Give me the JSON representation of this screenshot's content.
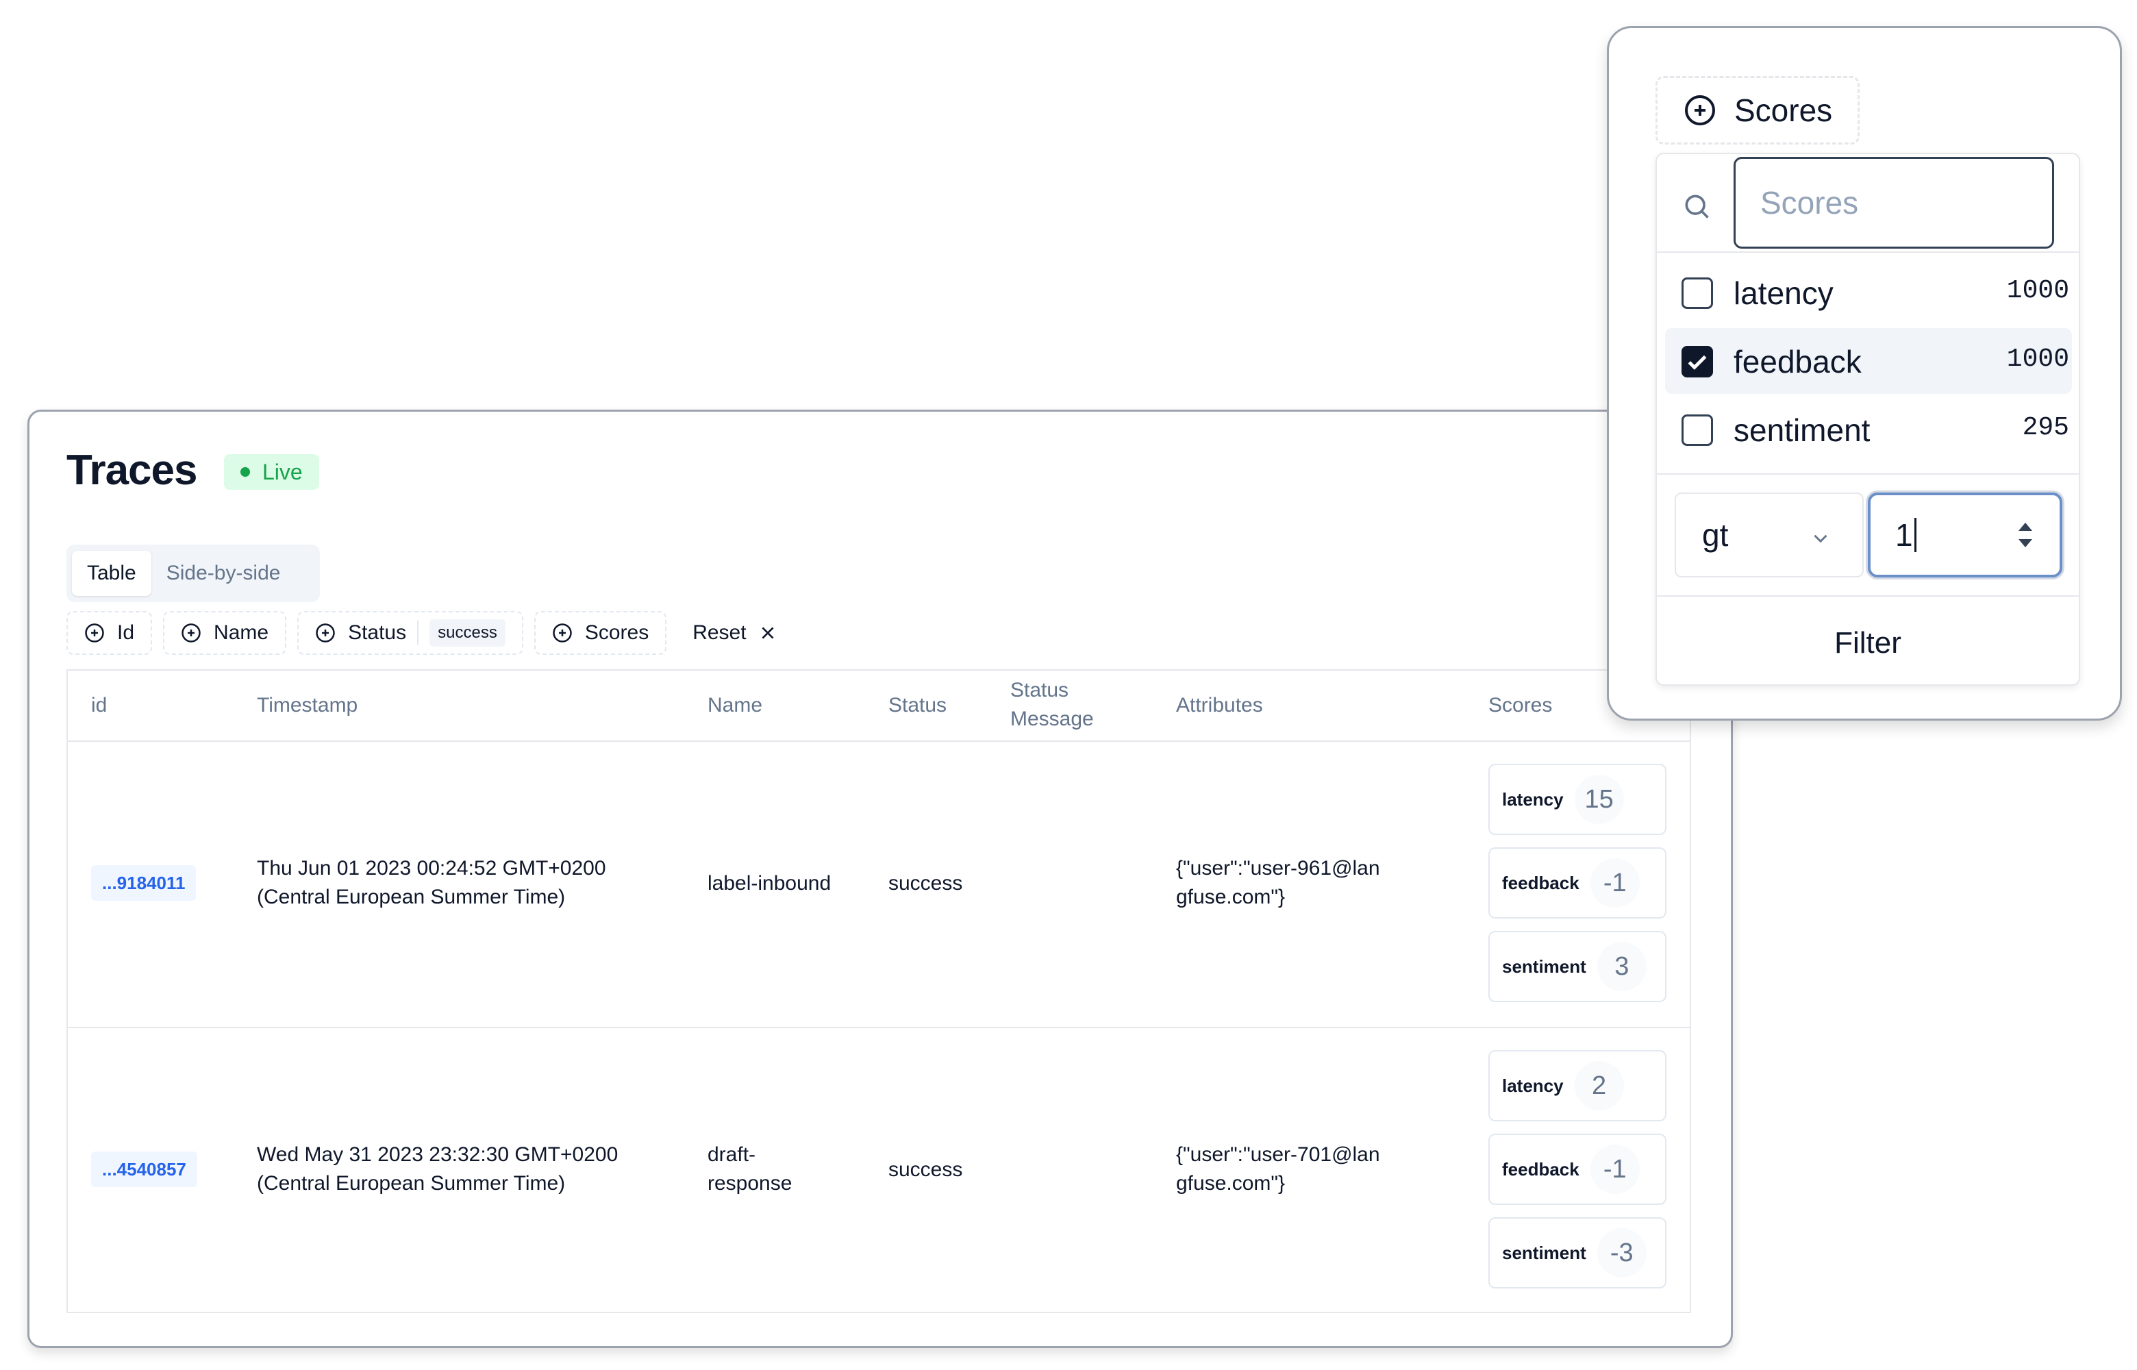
{
  "traces": {
    "title": "Traces",
    "live_label": "Live",
    "tabs": [
      {
        "label": "Table",
        "active": true
      },
      {
        "label": "Side-by-side",
        "active": false
      }
    ],
    "filters": [
      {
        "label": "Id"
      },
      {
        "label": "Name"
      },
      {
        "label": "Status",
        "value": "success"
      },
      {
        "label": "Scores"
      }
    ],
    "reset_label": "Reset",
    "columns": [
      "id",
      "Timestamp",
      "Name",
      "Status",
      "Status Message",
      "Attributes",
      "Scores"
    ],
    "rows": [
      {
        "id": "...9184011",
        "timestamp": "Thu Jun 01 2023 00:24:52 GMT+0200 (Central European Summer Time)",
        "name": "label-inbound",
        "status": "success",
        "status_message": "",
        "attributes": "{\"user\":\"user-961@langfuse.com\"}",
        "scores": [
          {
            "name": "latency",
            "value": "15"
          },
          {
            "name": "feedback",
            "value": "-1"
          },
          {
            "name": "sentiment",
            "value": "3"
          }
        ]
      },
      {
        "id": "...4540857",
        "timestamp": "Wed May 31 2023 23:32:30 GMT+0200 (Central European Summer Time)",
        "name": "draft-response",
        "status": "success",
        "status_message": "",
        "attributes": "{\"user\":\"user-701@langfuse.com\"}",
        "scores": [
          {
            "name": "latency",
            "value": "2"
          },
          {
            "name": "feedback",
            "value": "-1"
          },
          {
            "name": "sentiment",
            "value": "-3"
          }
        ]
      }
    ]
  },
  "scores_popover": {
    "trigger_label": "Scores",
    "search_placeholder": "Scores",
    "options": [
      {
        "name": "latency",
        "count": "1000",
        "checked": false
      },
      {
        "name": "feedback",
        "count": "1000",
        "checked": true
      },
      {
        "name": "sentiment",
        "count": "295",
        "checked": false
      }
    ],
    "operator": "gt",
    "value": "1",
    "filter_label": "Filter"
  },
  "colors": {
    "live_green": "#16a34a",
    "id_blue": "#2563eb",
    "focus_ring": "#6b8fc9"
  },
  "icons": [
    "plus-circle-icon",
    "x-icon",
    "search-icon",
    "check-icon",
    "chevron-down-icon",
    "spinner-arrows-icon"
  ]
}
